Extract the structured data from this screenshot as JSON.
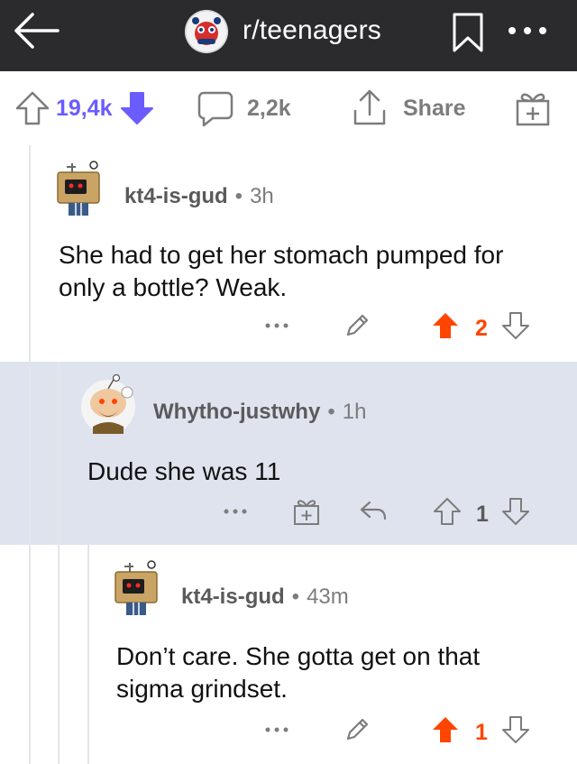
{
  "header": {
    "subreddit": "r/teenagers"
  },
  "actions": {
    "votes": "19,4k",
    "comments": "2,2k",
    "share": "Share"
  },
  "comments": [
    {
      "author": "kt4-is-gud",
      "dot": "•",
      "time": "3h",
      "body": "She had to get her stomach pumped for only a bottle? Weak.",
      "more": "•••",
      "score": "2",
      "vote_color": "#ff4500"
    },
    {
      "author": "Whytho-justwhy",
      "dot": "•",
      "time": "1h",
      "body": "Dude she was 11",
      "more": "•••",
      "score": "1",
      "vote_color": "#7c7c7c"
    },
    {
      "author": "kt4-is-gud",
      "dot": "•",
      "time": "43m",
      "body": "Don’t care. She gotta get on that sigma grindset.",
      "more": "•••",
      "score": "1",
      "vote_color": "#ff4500"
    }
  ],
  "colors": {
    "topbar": "#2b2b2d",
    "upvote_active": "#ff4500",
    "downvote_active": "#6a5cff",
    "highlight_bg": "#dfe3ed"
  }
}
